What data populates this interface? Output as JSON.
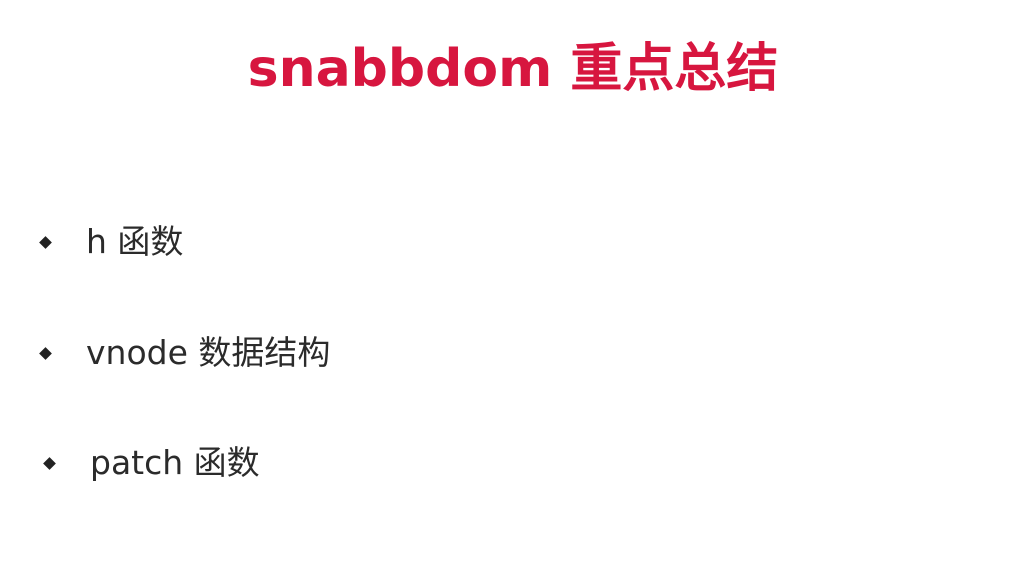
{
  "slide": {
    "title": "snabbdom 重点总结",
    "accent_color": "#d7163f",
    "bullets": [
      {
        "icon": "diamond-bullet-icon",
        "text": "h 函数"
      },
      {
        "icon": "diamond-bullet-icon",
        "text": "vnode 数据结构"
      },
      {
        "icon": "diamond-bullet-icon",
        "text": "patch 函数"
      }
    ]
  }
}
